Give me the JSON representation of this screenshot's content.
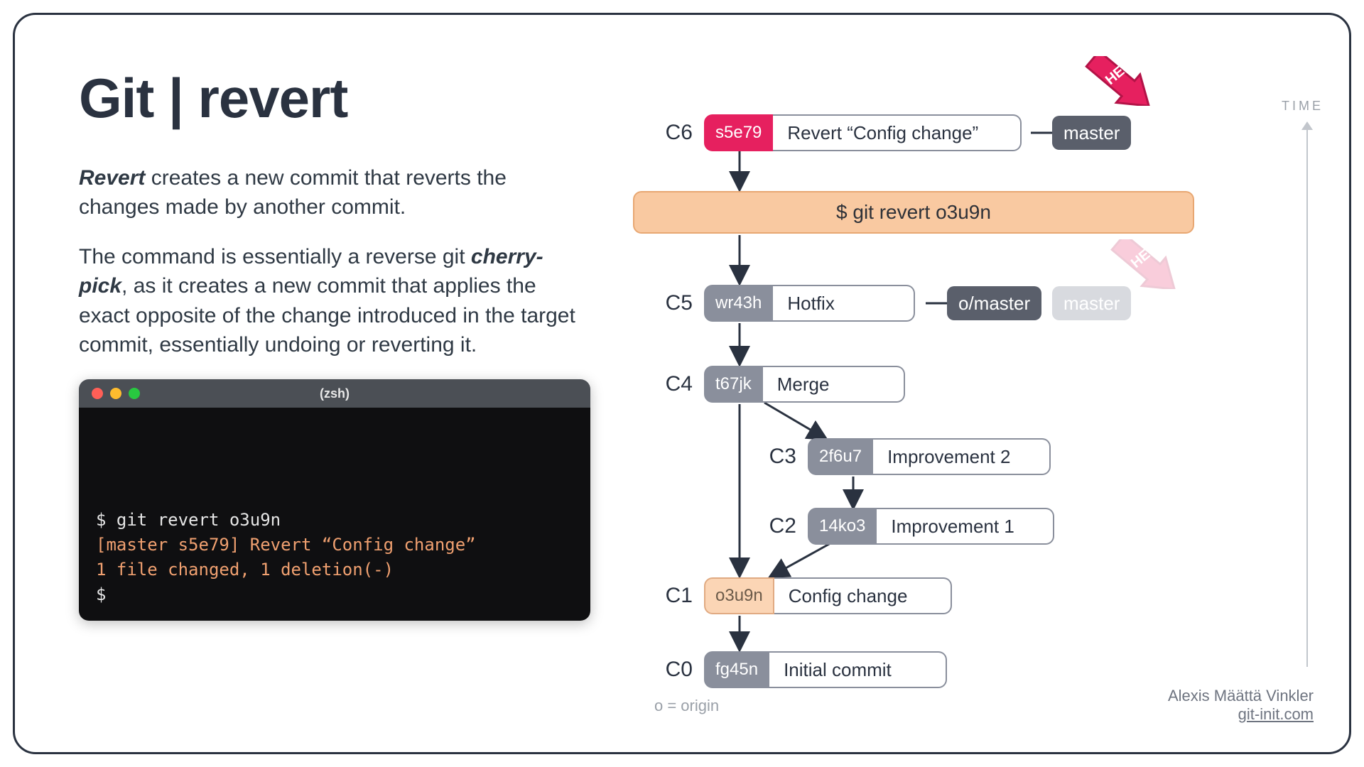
{
  "title": "Git | revert",
  "para1_strong": "Revert",
  "para1_rest": " creates a new commit that reverts the changes made by another commit.",
  "para2_a": "The command is essentially a reverse git ",
  "para2_strong": "cherry-pick",
  "para2_b": ", as it creates a new commit that applies the exact opposite of the change introduced in the target commit, essentially undoing or reverting it.",
  "terminal": {
    "title": "(zsh)",
    "line1": "git revert o3u9n",
    "line2": "[master s5e79] Revert “Config change”",
    "line3": "1 file changed, 1 deletion(-)",
    "line4": "$"
  },
  "commandbar": "$ git revert o3u9n",
  "commits": {
    "c6": {
      "label": "C6",
      "hash": "s5e79",
      "msg": "Revert “Config change”"
    },
    "c5": {
      "label": "C5",
      "hash": "wr43h",
      "msg": "Hotfix"
    },
    "c4": {
      "label": "C4",
      "hash": "t67jk",
      "msg": "Merge"
    },
    "c3": {
      "label": "C3",
      "hash": "2f6u7",
      "msg": "Improvement 2"
    },
    "c2": {
      "label": "C2",
      "hash": "14ko3",
      "msg": "Improvement 1"
    },
    "c1": {
      "label": "C1",
      "hash": "o3u9n",
      "msg": "Config change"
    },
    "c0": {
      "label": "C0",
      "hash": "fg45n",
      "msg": "Initial commit"
    }
  },
  "branches": {
    "master": "master",
    "omaster": "o/master",
    "master_old": "master"
  },
  "head_label": "HEAD",
  "time_label": "TIME",
  "legend": "o = origin",
  "credit_name": "Alexis Määttä Vinkler",
  "credit_site": "git-init.com"
}
